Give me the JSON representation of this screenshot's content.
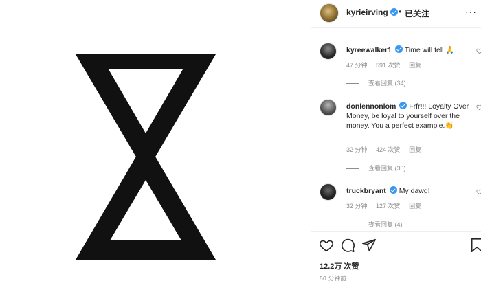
{
  "header": {
    "username": "kyrieirving",
    "separator": "•",
    "follow_label": "已关注",
    "more_label": "···"
  },
  "comments": [
    {
      "username": "kyreewalker1",
      "text": "Time will tell 🙏",
      "age": "47 分钟",
      "likes": "591 次赞",
      "reply_label": "回复",
      "view_replies": "查看回复 (34)"
    },
    {
      "username": "donlennonlom",
      "text": "Frfr!!! Loyalty Over Money, be loyal to yourself over the money. You a perfect example.👏",
      "age": "32 分钟",
      "likes": "424 次赞",
      "reply_label": "回复",
      "view_replies": "查看回复 (30)"
    },
    {
      "username": "truckbryant",
      "text": "My dawg!",
      "age": "32 分钟",
      "likes": "127 次赞",
      "reply_label": "回复",
      "view_replies": "查看回复 (4)"
    }
  ],
  "post": {
    "likes": "12.2万 次赞",
    "time": "50 分钟前"
  },
  "icons": {
    "heart": "heart-icon",
    "comment": "comment-icon",
    "share": "share-icon",
    "save": "bookmark-icon"
  },
  "colors": {
    "verified": "#3897f0",
    "muted_text": "#8e8e8e",
    "text": "#262626"
  }
}
